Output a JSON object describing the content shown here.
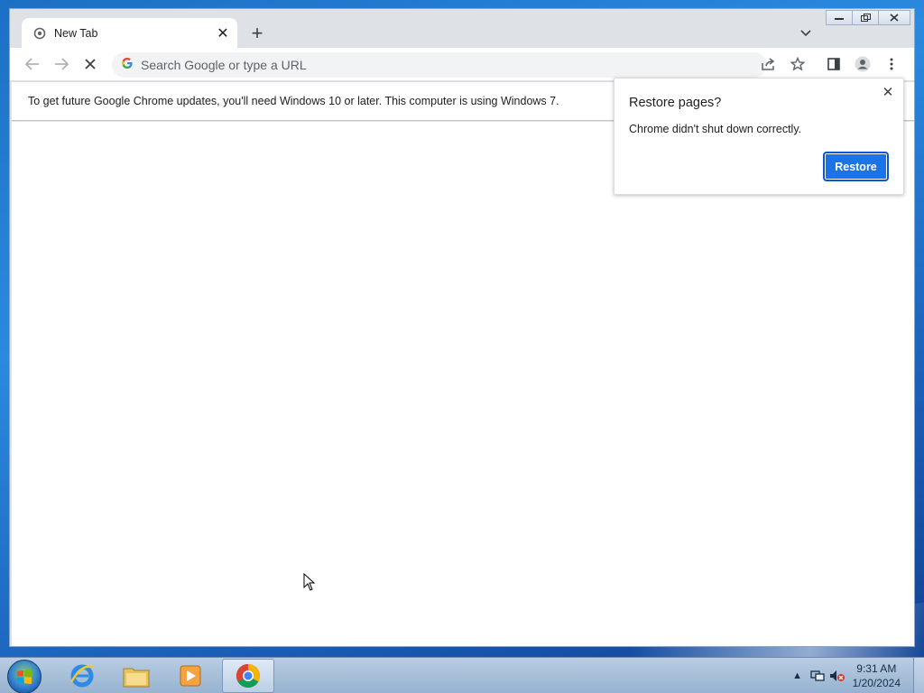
{
  "browser": {
    "tab": {
      "title": "New Tab",
      "favicon": "chrome-loading-icon"
    },
    "omnibox": {
      "placeholder": "Search Google or type a URL"
    },
    "infobar": {
      "message": "To get future Google Chrome updates, you'll need Windows 10 or later. This computer is using Windows 7."
    },
    "restore_bubble": {
      "title": "Restore pages?",
      "body": "Chrome didn't shut down correctly.",
      "restore_label": "Restore"
    },
    "accent_color": "#1a73e8"
  },
  "taskbar": {
    "apps": [
      "internet-explorer-icon",
      "file-explorer-icon",
      "media-player-icon",
      "chrome-icon"
    ],
    "clock": {
      "time": "9:31 AM",
      "date": "1/20/2024"
    }
  }
}
